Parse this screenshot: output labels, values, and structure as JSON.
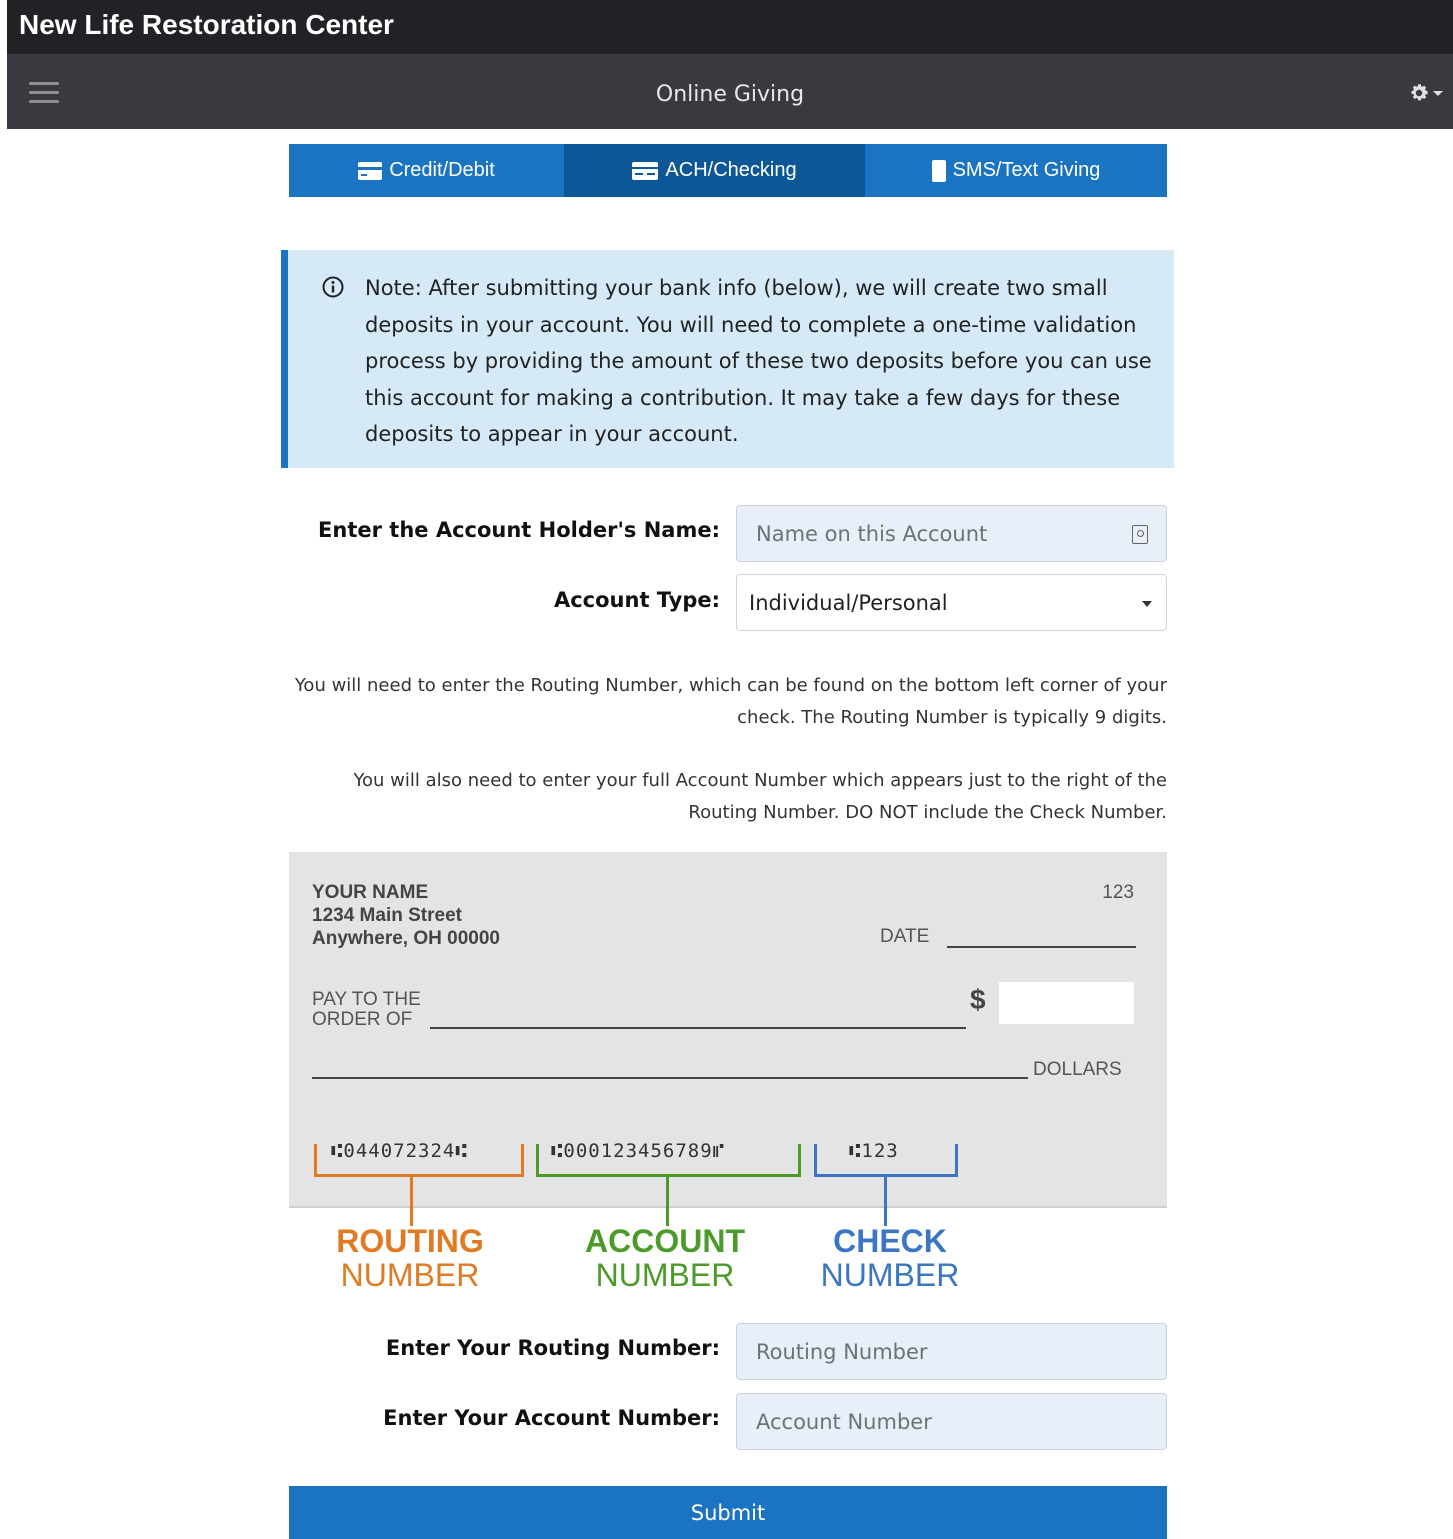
{
  "header": {
    "org_name": "New Life Restoration Center"
  },
  "navbar": {
    "title": "Online Giving"
  },
  "tabs": [
    {
      "label": "Credit/Debit",
      "active": false
    },
    {
      "label": "ACH/Checking",
      "active": true
    },
    {
      "label": "SMS/Text Giving",
      "active": false
    }
  ],
  "note": {
    "text": "Note: After submitting your bank info (below), we will create two small deposits in your account. You will need to complete a one-time validation process by providing the amount of these two deposits before you can use this account for making a contribution. It may take a few days for these deposits to appear in your account."
  },
  "form": {
    "holder_label": "Enter the Account Holder's Name:",
    "holder_placeholder": "Name on this Account",
    "type_label": "Account Type:",
    "type_value": "Individual/Personal",
    "routing_label": "Enter Your Routing Number:",
    "routing_placeholder": "Routing Number",
    "account_label": "Enter Your Account Number:",
    "account_placeholder": "Account Number",
    "submit_label": "Submit"
  },
  "help": {
    "routing_text": "You will need to enter the Routing Number, which can be found on the bottom left corner of your check. The Routing Number is typically 9 digits.",
    "account_text": "You will also need to enter your full Account Number which appears just to the right of the Routing Number. DO NOT include the Check Number."
  },
  "check": {
    "name": "YOUR NAME",
    "street": "1234 Main Street",
    "city": "Anywhere, OH 00000",
    "check_no": "123",
    "date_label": "DATE",
    "pay_to_1": "PAY TO THE",
    "pay_to_2": "ORDER OF",
    "dollar_sign": "$",
    "dollars_label": "DOLLARS",
    "micr_routing": "⑆044072324⑆",
    "micr_account": "⑆000123456789⑈",
    "micr_check": "⑆123"
  },
  "legend": {
    "routing_1": "ROUTING",
    "routing_2": "NUMBER",
    "account_1": "ACCOUNT",
    "account_2": "NUMBER",
    "check_1": "CHECK",
    "check_2": "NUMBER"
  },
  "colors": {
    "routing": "#e07b24",
    "account": "#4c9a2a",
    "check": "#3b76c4",
    "primary": "#1b74c2"
  },
  "icons": {
    "menu": "hamburger-icon",
    "settings": "gear-icon",
    "info": "info-circle-icon"
  }
}
